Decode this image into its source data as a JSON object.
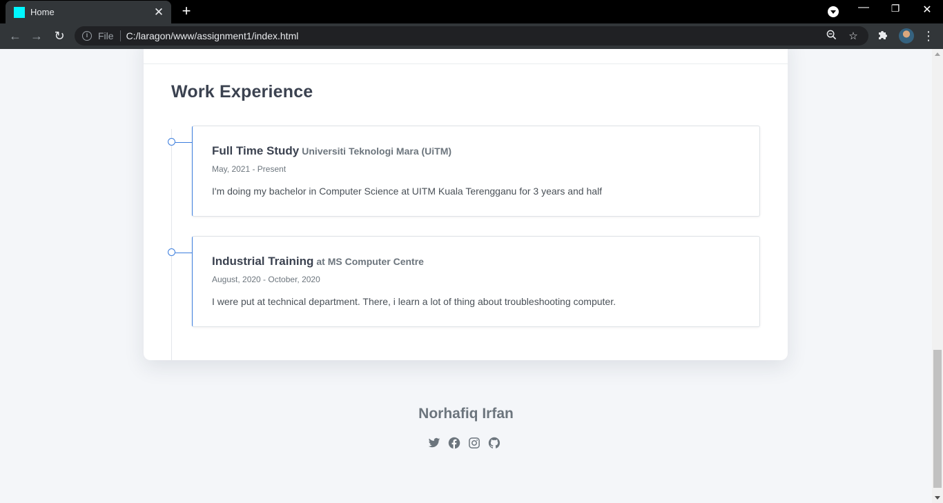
{
  "browser": {
    "tab_title": "Home",
    "tab_close": "✕",
    "new_tab": "+",
    "scheme_label": "File",
    "url": "C:/laragon/www/assignment1/index.html",
    "favicon_color": "#00f7ff"
  },
  "work": {
    "title": "Work Experience",
    "items": [
      {
        "role": "Full Time Study",
        "org": "Universiti Teknologi Mara (UiTM)",
        "date": "May, 2021 - Present",
        "description": "I'm doing my bachelor in Computer Science at UITM Kuala Terengganu for 3 years and half"
      },
      {
        "role": "Industrial Training",
        "org": "at MS Computer Centre",
        "date": "August, 2020 - October, 2020",
        "description": "I were put at technical department. There, i learn a lot of thing about troubleshooting computer."
      }
    ]
  },
  "footer": {
    "name": "Norhafiq Irfan",
    "social": [
      "twitter-icon",
      "facebook-icon",
      "instagram-icon",
      "github-icon"
    ]
  },
  "colors": {
    "accent": "#3b7ddd",
    "heading": "#3b4250",
    "muted": "#6c757d",
    "background": "#f4f6f9"
  }
}
